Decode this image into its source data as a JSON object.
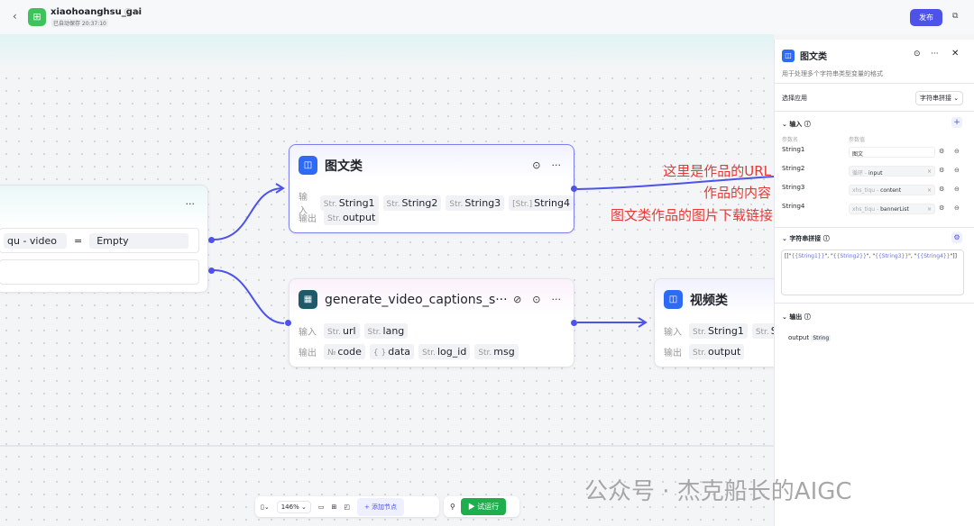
{
  "header": {
    "app_name": "xiaohoanghsu_gai",
    "saved": "已自动保存 20:37:10",
    "publish": "发布"
  },
  "nodes": {
    "condition": {
      "left_value": "qu  -  video",
      "operator": "=",
      "right_value": "Empty"
    },
    "tuwen": {
      "title": "图文类",
      "input_label": "输入",
      "output_label": "输出",
      "inputs": [
        "String1",
        "String2",
        "String3",
        "String4"
      ],
      "input_types": [
        "Str.",
        "Str.",
        "Str.",
        "[Str.]"
      ],
      "outputs": [
        "output"
      ],
      "output_types": [
        "Str."
      ]
    },
    "captions": {
      "title": "generate_video_captions_s···",
      "input_label": "输入",
      "output_label": "输出",
      "inputs": [
        "url",
        "lang"
      ],
      "input_types": [
        "Str.",
        "Str."
      ],
      "outputs": [
        "code",
        "data",
        "log_id",
        "msg"
      ],
      "output_types": [
        "№",
        "{ }",
        "Str.",
        "Str."
      ]
    },
    "video": {
      "title": "视频类",
      "input_label": "输入",
      "output_label": "输出",
      "inputs": [
        "String1",
        "Str"
      ],
      "input_types": [
        "Str.",
        "Str."
      ],
      "outputs": [
        "output"
      ],
      "output_types": [
        "Str."
      ]
    }
  },
  "annotations": [
    "这里是作品的URL",
    "作品的内容",
    "图文类作品的图片下载链接"
  ],
  "panel": {
    "title": "图文类",
    "description": "用于处理多个字符串类型变量的格式",
    "select_app_label": "选择应用",
    "select_app_value": "字符串拼接",
    "input_section": "输入",
    "col_name": "参数名",
    "col_value": "参数值",
    "params": [
      {
        "name": "String1",
        "value": "图文",
        "src": ""
      },
      {
        "name": "String2",
        "src": "循环 -",
        "value": "input"
      },
      {
        "name": "String3",
        "src": "xhs_tiqu -",
        "value": "content"
      },
      {
        "name": "String4",
        "src": "xhs_tiqu -",
        "value": "bannerList"
      }
    ],
    "concat_section": "字符串拼接",
    "concat_parts": [
      "[[\"",
      "{{String1}}",
      "\", \"",
      "{{String2}}",
      "\",  \"",
      "{{String3}}",
      "\", \"",
      "{{String4}}",
      "\"]]"
    ],
    "output_section": "输出",
    "output_name": "output",
    "output_type": "String"
  },
  "toolbar": {
    "zoom": "146%",
    "add_node": "添加节点",
    "run": "试运行"
  },
  "watermark": "公众号 · 杰克船长的AIGC",
  "colors": {
    "accent": "#4d53e8",
    "run": "#1fae4c",
    "annotation": "#e53935"
  }
}
